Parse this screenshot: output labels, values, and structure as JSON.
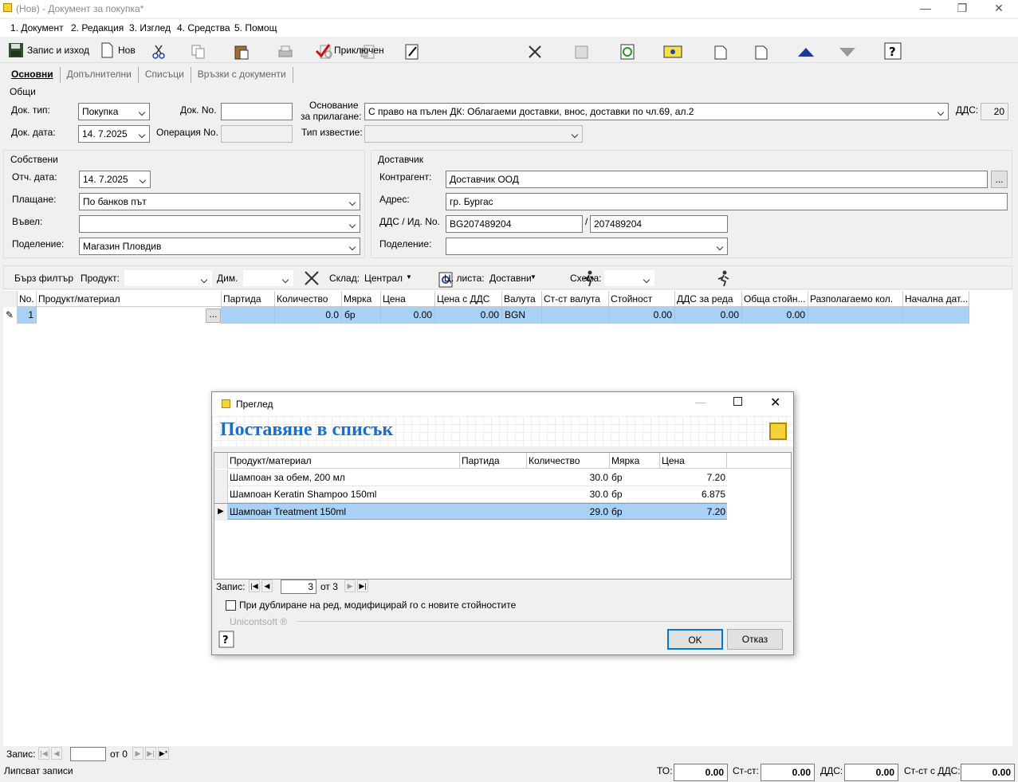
{
  "window": {
    "title": "(Нов) - Документ за покупка*",
    "minimize": "—",
    "restore": "❐",
    "close": "✕"
  },
  "menu": [
    "1. Документ",
    "2. Редакция",
    "3. Изглед",
    "4. Средства",
    "5. Помощ"
  ],
  "toolbar": {
    "save_exit": "Запис и изход",
    "new": "Нов",
    "finished": "Приключен"
  },
  "tabs": [
    "Основни",
    "Допълнителни",
    "Списъци",
    "Връзки с документи"
  ],
  "general": {
    "title": "Общи",
    "doc_type_label": "Док. тип:",
    "doc_type": "Покупка",
    "doc_no_label": "Док. No.",
    "doc_no": "",
    "basis_label_1": "Основание",
    "basis_label_2": "за прилагане:",
    "basis": "С право на пълен ДК: Облагаеми доставки, внос, доставки по чл.69, ал.2",
    "vat_label": "ДДС:",
    "vat": "20",
    "doc_date_label": "Док. дата:",
    "doc_date": "14.  7.2025",
    "op_no_label": "Операция No.",
    "op_no": "",
    "notice_label": "Тип известие:",
    "notice": ""
  },
  "own": {
    "title": "Собствени",
    "report_date_label": "Отч. дата:",
    "report_date": "14.  7.2025",
    "payment_label": "Плащане:",
    "payment": "По банков път",
    "entered_label": "Въвел:",
    "entered": "",
    "division_label": "Поделение:",
    "division": "Магазин Пловдив"
  },
  "supplier": {
    "title": "Доставчик",
    "partner_label": "Контрагент:",
    "partner": "Доставчик ООД",
    "partner_btn": "...",
    "address_label": "Адрес:",
    "address": "гр. Бургас",
    "vat_id_label": "ДДС / Ид. No.",
    "vat_no": "BG207489204",
    "sep": "/",
    "id_no": "207489204",
    "division_label": "Поделение:",
    "division": ""
  },
  "filter": {
    "quick": "Бърз филтър",
    "product_label": "Продукт:",
    "product": "",
    "dim_label": "Дим.",
    "dim": "",
    "store_label": "Склад:",
    "store": "Централ",
    "price_list_label": "Ц. листа:",
    "price_list": "Доставни",
    "scheme_label": "Схема:",
    "scheme": ""
  },
  "grid": {
    "headers": [
      "No.",
      "Продукт/материал",
      "Партида",
      "Количество",
      "Мярка",
      "Цена",
      "Цена с ДДС",
      "Валута",
      "Ст-ст валута",
      "Стойност",
      "ДДС за реда",
      "Обща стойн...",
      "Разполагаемо кол.",
      "Начална дат..."
    ],
    "row": {
      "no": "1",
      "product": "",
      "btn": "...",
      "batch": "",
      "qty": "0.0",
      "unit": "бр",
      "price": "0.00",
      "price_vat": "0.00",
      "currency": "BGN",
      "cur_value": "",
      "value": "0.00",
      "vat_row": "0.00",
      "total": "0.00"
    }
  },
  "bottom": {
    "record_label": "Запис:",
    "record": "",
    "of": "от 0",
    "status": "Липсват записи",
    "to_label": "ТО:",
    "to": "0.00",
    "value_label": "Ст-ст:",
    "value": "0.00",
    "vat_label": "ДДС:",
    "vat": "0.00",
    "total_label": "Ст-ст с ДДС:",
    "total": "0.00"
  },
  "dialog": {
    "title": "Преглед",
    "heading": "Поставяне в списък",
    "headers": [
      "Продукт/материал",
      "Партида",
      "Количество",
      "Мярка",
      "Цена"
    ],
    "rows": [
      {
        "product": "Шампоан за обем, 200 мл",
        "batch": "",
        "qty": "30.0",
        "unit": "бр",
        "price": "7.20"
      },
      {
        "product": "Шампоан Keratin Shampoo 150ml",
        "batch": "",
        "qty": "30.0",
        "unit": "бр",
        "price": "6.875"
      },
      {
        "product": "Шампоан Treatment 150ml",
        "batch": "",
        "qty": "29.0",
        "unit": "бр",
        "price": "7.20"
      }
    ],
    "record_label": "Запис:",
    "record": "3",
    "of": "от 3",
    "checkbox_label": "При дублиране на ред, модифицирай го с новите стойностите",
    "brand": "Unicontsoft ®",
    "ok": "OK",
    "cancel": "Отказ"
  },
  "colors": {
    "selection": "#a9d0f5",
    "heading": "#1a6fc9",
    "accent_icon": "#f4d23a"
  }
}
